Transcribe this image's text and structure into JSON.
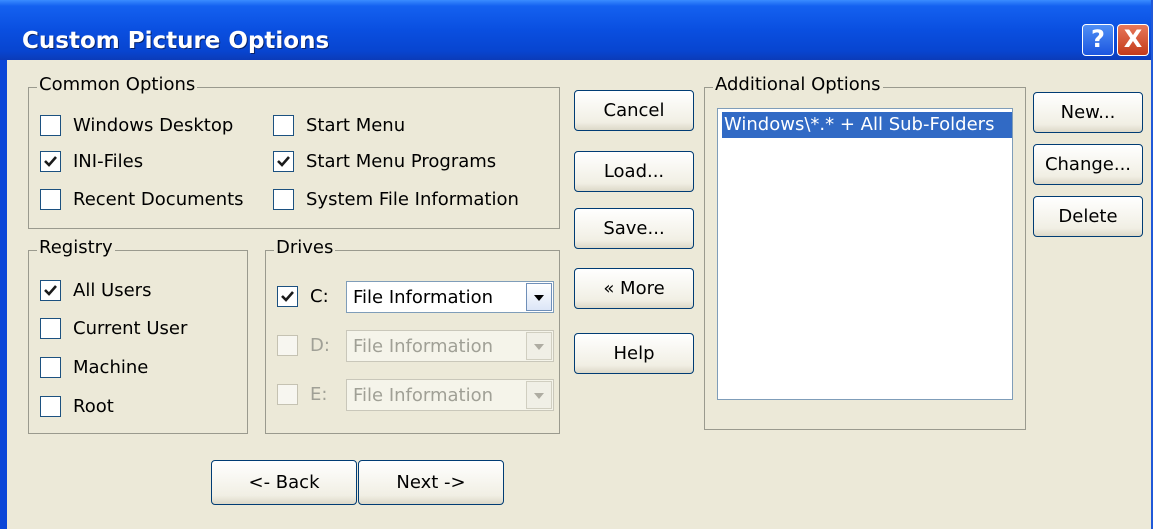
{
  "window": {
    "title": "Custom Picture Options",
    "help_glyph": "?",
    "close_glyph": "X"
  },
  "common_options": {
    "legend": "Common Options",
    "items": [
      {
        "label": "Windows Desktop",
        "checked": false
      },
      {
        "label": "INI-Files",
        "checked": true
      },
      {
        "label": "Recent Documents",
        "checked": false
      },
      {
        "label": "Start Menu",
        "checked": false
      },
      {
        "label": "Start Menu Programs",
        "checked": true
      },
      {
        "label": "System File Information",
        "checked": false
      }
    ]
  },
  "registry": {
    "legend": "Registry",
    "items": [
      {
        "label": "All Users",
        "checked": true
      },
      {
        "label": "Current User",
        "checked": false
      },
      {
        "label": "Machine",
        "checked": false
      },
      {
        "label": "Root",
        "checked": false
      }
    ]
  },
  "drives": {
    "legend": "Drives",
    "items": [
      {
        "label": "C:",
        "checked": true,
        "value": "File Information",
        "enabled": true
      },
      {
        "label": "D:",
        "checked": false,
        "value": "File Information",
        "enabled": false
      },
      {
        "label": "E:",
        "checked": false,
        "value": "File Information",
        "enabled": false
      }
    ]
  },
  "middle_buttons": {
    "cancel": "Cancel",
    "load": "Load...",
    "save": "Save...",
    "more": "« More",
    "help": "Help"
  },
  "additional_options": {
    "legend": "Additional Options",
    "items": [
      "Windows\\*.* + All Sub-Folders"
    ],
    "selected_index": 0
  },
  "right_buttons": {
    "new": "New...",
    "change": "Change...",
    "delete": "Delete"
  },
  "nav": {
    "back": "<- Back",
    "next": "Next ->"
  },
  "colors": {
    "title_bar": "#0a4fe0",
    "face": "#ece9d8",
    "selection": "#316ac5",
    "checkmark": "#21a121"
  }
}
